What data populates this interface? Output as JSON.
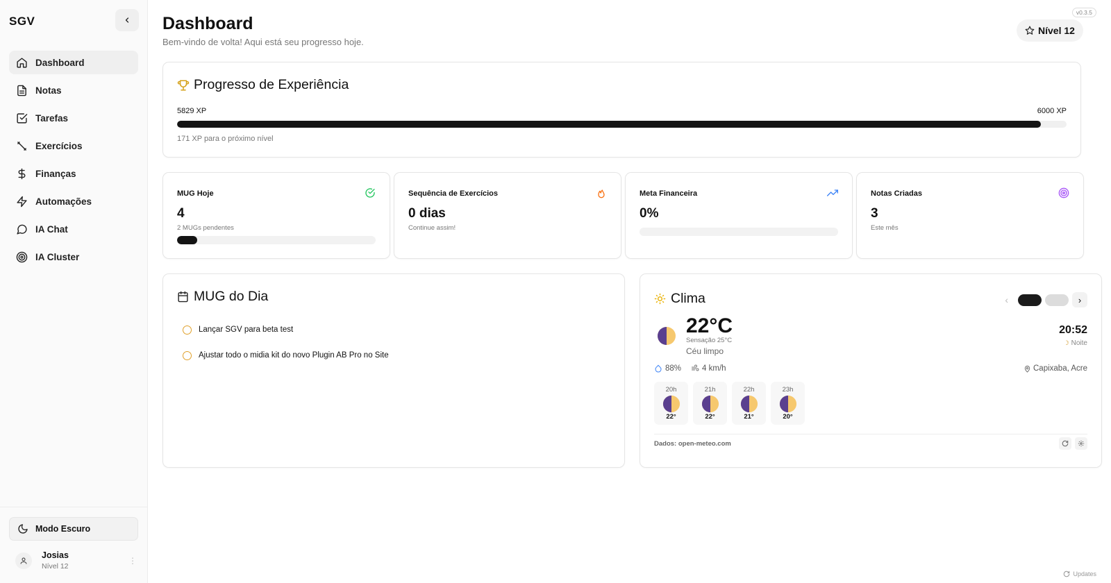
{
  "app": {
    "brand": "SGV",
    "version": "v0.3.5"
  },
  "sidebar": {
    "items": [
      {
        "label": "Dashboard",
        "icon": "home-icon",
        "active": true
      },
      {
        "label": "Notas",
        "icon": "document-icon"
      },
      {
        "label": "Tarefas",
        "icon": "checkbox-icon"
      },
      {
        "label": "Exercícios",
        "icon": "dumbbell-icon"
      },
      {
        "label": "Finanças",
        "icon": "dollar-icon"
      },
      {
        "label": "Automações",
        "icon": "bolt-icon"
      },
      {
        "label": "IA Chat",
        "icon": "chat-icon"
      },
      {
        "label": "IA Cluster",
        "icon": "target-icon"
      }
    ],
    "dark_mode_label": "Modo Escuro",
    "user": {
      "name": "Josias",
      "level": "Nível 12"
    }
  },
  "header": {
    "title": "Dashboard",
    "subtitle": "Bem-vindo de volta! Aqui está seu progresso hoje.",
    "level_badge": "Nível 12"
  },
  "xp": {
    "title": "Progresso de Experiência",
    "current": "5829 XP",
    "target": "6000 XP",
    "progress_fraction": 0.9715,
    "note": "171 XP para o próximo nível"
  },
  "stats": [
    {
      "label": "MUG Hoje",
      "value": "4",
      "sub": "2 MUGs pendentes",
      "progress_fraction": 0.1,
      "icon": "check-circle-icon",
      "color": "#22c55e"
    },
    {
      "label": "Sequência de Exercícios",
      "value": "0 dias",
      "sub": "Continue assim!",
      "icon": "flame-icon",
      "color": "#f97316"
    },
    {
      "label": "Meta Financeira",
      "value": "0%",
      "sub": "",
      "progress_fraction": 0,
      "icon": "trending-up-icon",
      "color": "#3b82f6"
    },
    {
      "label": "Notas Criadas",
      "value": "3",
      "sub": "Este mês",
      "icon": "target-icon",
      "color": "#a855f7"
    }
  ],
  "mug": {
    "title": "MUG do Dia",
    "items": [
      "Lançar SGV para beta test",
      "Ajustar todo o midia kit do novo Plugin AB Pro no Site"
    ]
  },
  "weather": {
    "title": "Clima",
    "temp": "22°C",
    "feels": "Sensação 25°C",
    "desc": "Céu limpo",
    "time": "20:52",
    "period": "Noite",
    "humidity": "88%",
    "wind": "4 km/h",
    "location": "Capixaba, Acre",
    "hours": [
      {
        "h": "20h",
        "t": "22°"
      },
      {
        "h": "21h",
        "t": "22°"
      },
      {
        "h": "22h",
        "t": "21°"
      },
      {
        "h": "23h",
        "t": "20°"
      }
    ],
    "source": "Dados: open-meteo.com"
  },
  "footer": {
    "updates": "Updates"
  },
  "colors": {
    "accent": "#141414",
    "mug_circle": "#e0a02a",
    "trophy": "#d4a017"
  }
}
